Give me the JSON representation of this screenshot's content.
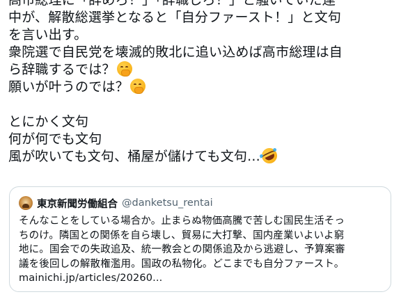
{
  "tweet": {
    "lines": [
      "高市総理に「辞めろ！」「辞職しろ！」と騒いでいた連",
      "中が、解散総選挙となると「自分ファースト！」と文句",
      "を言い出す。",
      "衆院選で自民党を壊滅的敗北に追い込めば高市総理は自",
      "ら辞職するでは？",
      "願いが叶うのでは？",
      "",
      "とにかく文句",
      "何が何でも文句",
      "風が吹いても文句、桶屋が儲けても文句..."
    ],
    "emojis": {
      "line5": "face-with-hand-over-mouth",
      "line6": "face-with-hand-over-mouth",
      "line10": "rolling-on-the-floor-laughing"
    }
  },
  "quote": {
    "author_name": "東京新聞労働組合",
    "author_handle": "@danketsu_rentai",
    "avatar_icon": "avatar-image",
    "lines": [
      "そんなことをしている場合か。止まらぬ物価高騰で苦しむ国民生活そっ",
      "ちのけ。隣国との関係を自ら壊し、貿易に大打撃、国内産業いよいよ窮",
      "地に。国会での失政追及、統一教会との関係追及から逃避し、予算案審",
      "議を後回しの解散権濫用。国政の私物化。どこまでも自分ファースト。",
      "mainichi.jp/articles/20260..."
    ]
  },
  "colors": {
    "text": "#0f1419",
    "secondary_text": "#536471",
    "card_border": "#cfd9de",
    "background": "#ffffff"
  }
}
